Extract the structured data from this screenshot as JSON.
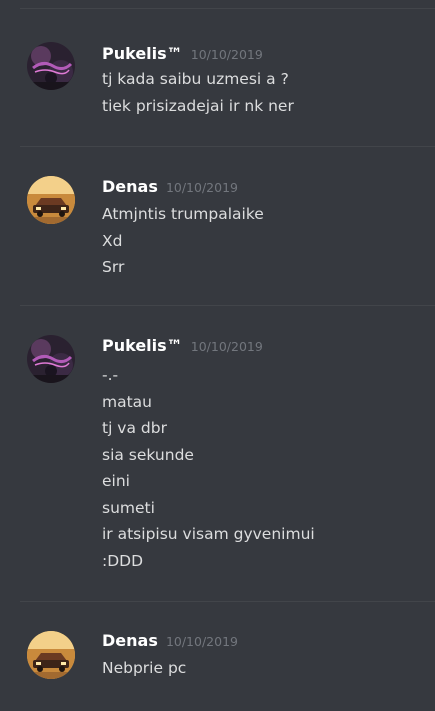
{
  "messages": [
    {
      "username": "Pukelis™",
      "timestamp": "10/10/2019",
      "avatar": "pukelis-avatar",
      "lines": [
        "tj kada saibu uzmesi a ?",
        "tiek prisizadejai ir nk ner"
      ]
    },
    {
      "username": "Denas",
      "timestamp": "10/10/2019",
      "avatar": "denas-avatar",
      "lines": [
        "Atmjntis trumpalaike",
        "Xd",
        "Srr"
      ]
    },
    {
      "username": "Pukelis™",
      "timestamp": "10/10/2019",
      "avatar": "pukelis-avatar",
      "lines": [
        "-.-",
        "matau",
        "tj va dbr",
        "sia sekunde",
        "eini",
        "sumeti",
        "ir atsipisu visam gyvenimui",
        ":DDD"
      ]
    },
    {
      "username": "Denas",
      "timestamp": "10/10/2019",
      "avatar": "denas-avatar",
      "lines": [
        "Nebprie pc"
      ]
    }
  ]
}
